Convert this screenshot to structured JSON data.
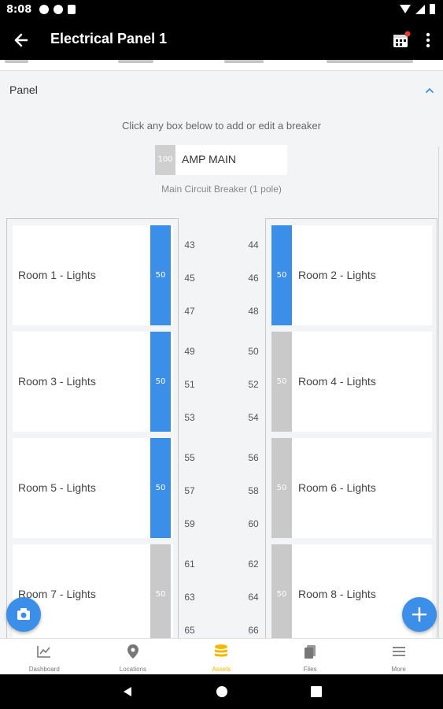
{
  "status_bar": {
    "time": "8:08"
  },
  "app_bar": {
    "title": "Electrical Panel 1"
  },
  "panel_section": {
    "header": "Panel",
    "hint": "Click any box below to add or edit a breaker",
    "main_breaker": {
      "amps": "100",
      "label": "AMP MAIN",
      "subtitle": "Main Circuit Breaker (1 pole)"
    }
  },
  "colors": {
    "active": "#3b8fe8",
    "inactive": "#c9c9c9",
    "nav_active": "#f5b700"
  },
  "breakers_left": [
    {
      "name": "Room 1 - Lights",
      "amps": "50",
      "active": true
    },
    {
      "name": "Room 3 - Lights",
      "amps": "50",
      "active": true
    },
    {
      "name": "Room 5 - Lights",
      "amps": "50",
      "active": true
    },
    {
      "name": "Room 7 - Lights",
      "amps": "50",
      "active": false
    }
  ],
  "breakers_right": [
    {
      "name": "Room 2 - Lights",
      "amps": "50",
      "active": true
    },
    {
      "name": "Room 4 - Lights",
      "amps": "50",
      "active": false
    },
    {
      "name": "Room 6 - Lights",
      "amps": "50",
      "active": false
    },
    {
      "name": "Room 8 - Lights",
      "amps": "50",
      "active": false
    }
  ],
  "slots_left": [
    "43",
    "45",
    "47",
    "49",
    "51",
    "53",
    "55",
    "57",
    "59",
    "61",
    "63",
    "65"
  ],
  "slots_right": [
    "44",
    "46",
    "48",
    "50",
    "52",
    "54",
    "56",
    "58",
    "60",
    "62",
    "64",
    "66"
  ],
  "bottom_nav": [
    {
      "label": "Dashboard",
      "icon": "chart-icon"
    },
    {
      "label": "Locations",
      "icon": "location-pin-icon"
    },
    {
      "label": "Assets",
      "icon": "stack-icon",
      "active": true
    },
    {
      "label": "Files",
      "icon": "files-icon"
    },
    {
      "label": "More",
      "icon": "menu-icon"
    }
  ]
}
